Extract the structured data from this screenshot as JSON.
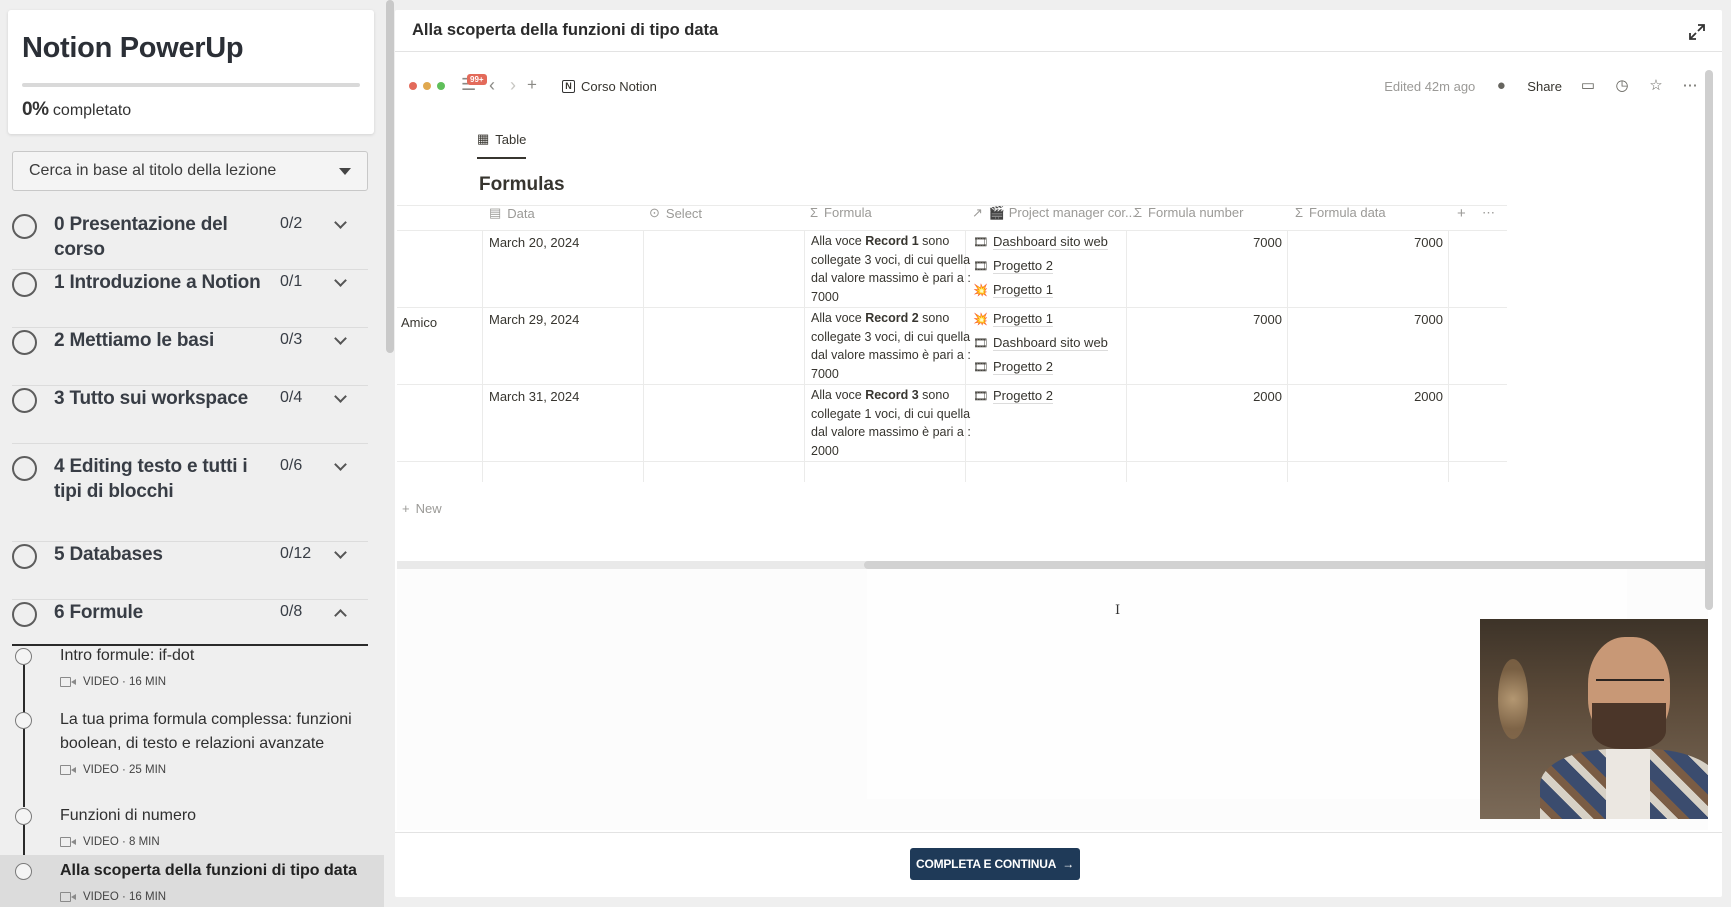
{
  "course": {
    "title": "Notion PowerUp",
    "progress_percent": 0,
    "progress_value": "0%",
    "progress_suffix": "completato"
  },
  "search": {
    "placeholder": "Cerca in base al titolo della lezione"
  },
  "sections": [
    {
      "label": "0 Presentazione del corso",
      "count": "0/2",
      "expanded": false
    },
    {
      "label": "1 Introduzione a Notion",
      "count": "0/1",
      "expanded": false
    },
    {
      "label": "2 Mettiamo le basi",
      "count": "0/3",
      "expanded": false
    },
    {
      "label": "3 Tutto sui workspace",
      "count": "0/4",
      "expanded": false
    },
    {
      "label": "4 Editing testo e tutti i tipi di blocchi",
      "count": "0/6",
      "expanded": false
    },
    {
      "label": "5 Databases",
      "count": "0/12",
      "expanded": false
    },
    {
      "label": "6 Formule",
      "count": "0/8",
      "expanded": true
    }
  ],
  "lessons": [
    {
      "title": "Intro formule: if-dot",
      "meta": "VIDEO · 16 MIN",
      "active": false
    },
    {
      "title": "La tua prima formula complessa: funzioni boolean, di testo e relazioni avanzate",
      "meta": "VIDEO · 25 MIN",
      "active": false
    },
    {
      "title": "Funzioni di numero",
      "meta": "VIDEO · 8 MIN",
      "active": false
    },
    {
      "title": "Alla scoperta della funzioni di tipo data",
      "meta": "VIDEO · 16 MIN",
      "active": true
    }
  ],
  "main": {
    "lesson_title": "Alla scoperta della funzioni di tipo data",
    "complete_button": "COMPLETA E CONTINUA",
    "complete_arrow": "→"
  },
  "notion": {
    "badge": "99+",
    "breadcrumb": "Corso Notion",
    "edited": "Edited 42m ago",
    "share": "Share",
    "view_tab": "Table",
    "db_title": "Formulas",
    "columns": [
      "Data",
      "Select",
      "Formula",
      "🎬 Project manager cor...",
      "Formula number",
      "Formula data"
    ],
    "rows": [
      {
        "name": "",
        "date": "March 20, 2024",
        "formula_pre": "Alla voce ",
        "formula_bold": "Record 1",
        "formula_post": " sono collegate 3 voci, di cui quella dal valore massimo è pari a : 7000",
        "projects": [
          {
            "icon": "🎞",
            "name": "Dashboard sito web"
          },
          {
            "icon": "🎞",
            "name": "Progetto 2"
          },
          {
            "icon": "💥",
            "name": "Progetto 1"
          }
        ],
        "formula_number": "7000",
        "formula_data": "7000"
      },
      {
        "name": "Amico",
        "date": "March 29, 2024",
        "formula_pre": "Alla voce ",
        "formula_bold": "Record 2",
        "formula_post": " sono collegate 3 voci, di cui quella dal valore massimo è pari a : 7000",
        "projects": [
          {
            "icon": "💥",
            "name": "Progetto 1"
          },
          {
            "icon": "🎞",
            "name": "Dashboard sito web"
          },
          {
            "icon": "🎞",
            "name": "Progetto 2"
          }
        ],
        "formula_number": "7000",
        "formula_data": "7000"
      },
      {
        "name": "",
        "date": "March 31, 2024",
        "formula_pre": "Alla voce ",
        "formula_bold": "Record 3",
        "formula_post": " sono collegate 1 voci, di cui quella dal valore massimo è pari a : 2000",
        "projects": [
          {
            "icon": "🎞",
            "name": "Progetto 2"
          }
        ],
        "formula_number": "2000",
        "formula_data": "2000"
      }
    ],
    "new_label": "New"
  },
  "colors": {
    "accent_button": "#1f3a58",
    "progress_fill": "#2b3a55",
    "traffic_red": "#e36a5a",
    "traffic_yellow": "#e0a84f",
    "traffic_green": "#5fbf5a"
  }
}
